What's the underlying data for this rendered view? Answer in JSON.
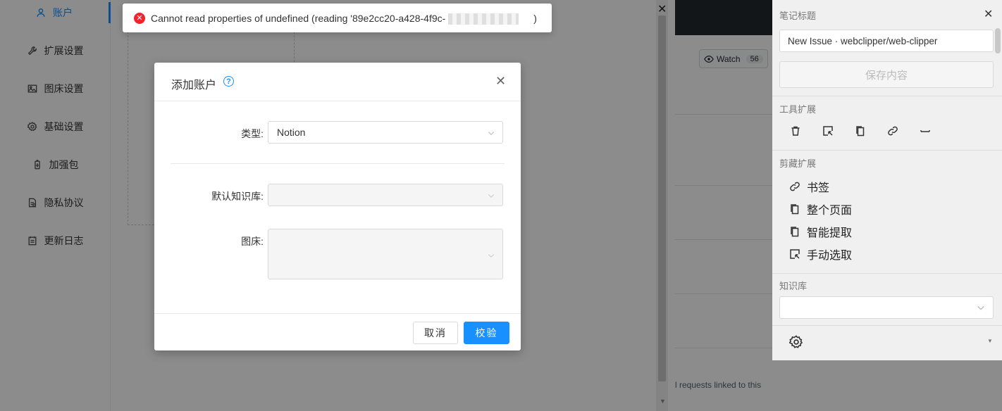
{
  "sidebar": {
    "items": [
      {
        "label": "账户",
        "icon": "user-icon",
        "active": true
      },
      {
        "label": "扩展设置",
        "icon": "wrench-icon"
      },
      {
        "label": "图床设置",
        "icon": "image-icon"
      },
      {
        "label": "基础设置",
        "icon": "gear-icon"
      },
      {
        "label": "加强包",
        "icon": "battery-icon"
      },
      {
        "label": "隐私协议",
        "icon": "document-icon"
      },
      {
        "label": "更新日志",
        "icon": "calendar-icon"
      }
    ]
  },
  "toast": {
    "type": "error",
    "message": "Cannot read properties of undefined (reading '89e2cc20-a428-4f9c-",
    "suffix": ")"
  },
  "modal": {
    "title": "添加账户",
    "help": "?",
    "fields": {
      "type_label": "类型:",
      "type_value": "Notion",
      "repo_label": "默认知识库:",
      "repo_value": "",
      "imagehost_label": "图床:",
      "imagehost_value": ""
    },
    "cancel_label": "取消",
    "verify_label": "校验"
  },
  "github": {
    "watch_label": "Watch",
    "watch_count": "56",
    "bottom_text": "l requests linked to this"
  },
  "clipper": {
    "note_title_label": "笔记标题",
    "note_title_value": "New Issue · webclipper/web-clipper",
    "save_label": "保存内容",
    "tools_label": "工具扩展",
    "tools": [
      "trash-icon",
      "select-area-icon",
      "copy-icon",
      "link-icon",
      "minus-icon"
    ],
    "clip_label": "剪藏扩展",
    "clip_items": [
      {
        "label": "书签",
        "icon": "link-icon"
      },
      {
        "label": "整个页面",
        "icon": "copy-icon"
      },
      {
        "label": "智能提取",
        "icon": "copy-icon"
      },
      {
        "label": "手动选取",
        "icon": "select-area-icon"
      }
    ],
    "repository_label": "知识库",
    "repository_value": ""
  },
  "colors": {
    "accent": "#1890ff",
    "error": "#f5222d",
    "github_header": "#24292e"
  }
}
